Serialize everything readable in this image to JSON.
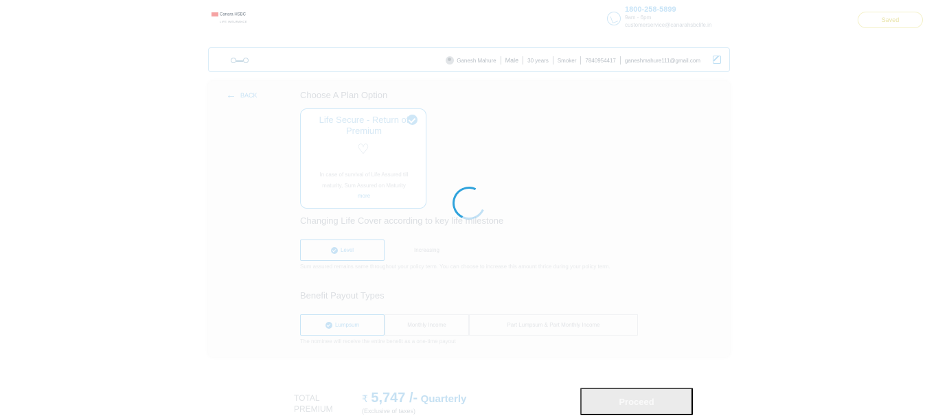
{
  "header": {
    "logo_text": "Canara HSBC",
    "logo_sub": "LIFE INSURANCE",
    "phone": "1800-258-5899",
    "hours": "9am - 6pm",
    "email": "customerservice@canarahsbclife.in",
    "saved_label": "Saved"
  },
  "customer": {
    "name": "Ganesh Mahure",
    "gender": "Male",
    "age": "30 years",
    "smoker": "Smoker",
    "phone": "7840954417",
    "email": "ganeshmahure111@gmail.com"
  },
  "main": {
    "back_label": "BACK",
    "plan_section_title": "Choose A Plan Option",
    "plan_card": {
      "name": "Life Secure - Return of Premium",
      "description": "In case of survival of Life Assured till maturity, Sum Assured on Maturity",
      "more_label": "more"
    },
    "cover_section_title": "Changing Life Cover according to key life milestone",
    "cover_options": [
      "Level",
      "Increasing"
    ],
    "cover_note": "Sum assured remains same throughout your policy term. You can choose to increase this amount thrice during your policy term.",
    "payout_section_title": "Benefit Payout Types",
    "payout_options": [
      "Lumpsum",
      "Monthly Income",
      "Part Lumpsum & Part Monthly Income"
    ],
    "payout_note": "The nominee will receive the entire benefit as a one-time payout"
  },
  "footer": {
    "total_label_1": "TOTAL",
    "total_label_2": "PREMIUM",
    "currency": "₹",
    "amount": "5,747 /-",
    "frequency": "Quarterly",
    "tax_note": "(Exclusive of taxes)",
    "proceed_label": "Proceed"
  },
  "colors": {
    "accent": "#1a9ad9",
    "button_disabled": "#ebebeb"
  }
}
